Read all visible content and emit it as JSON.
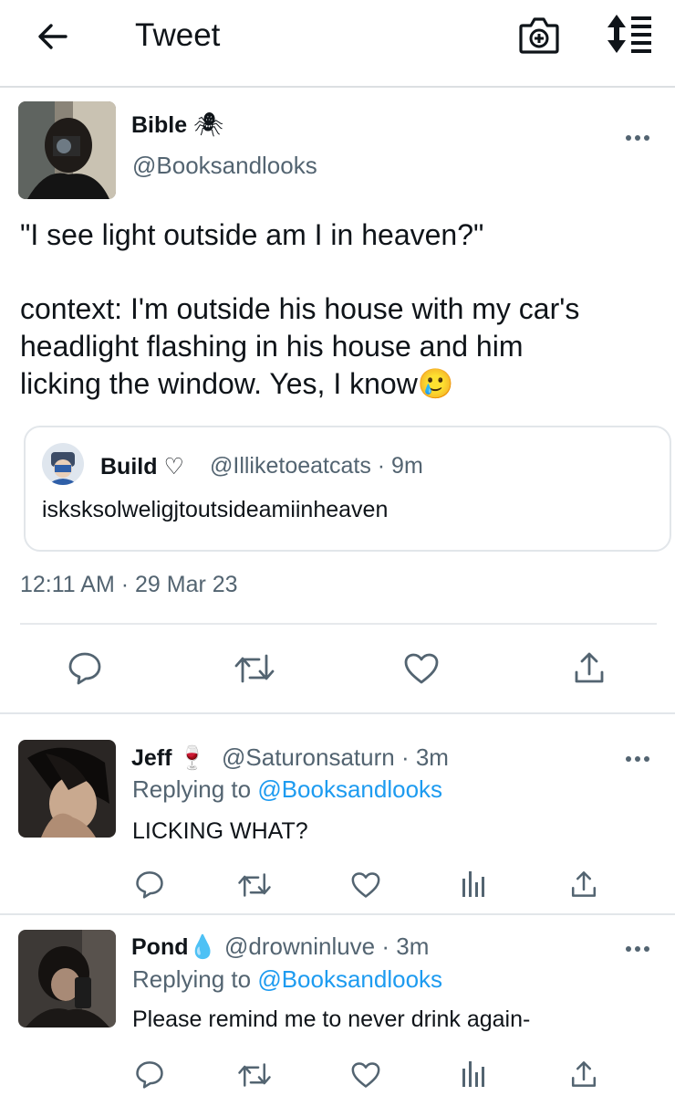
{
  "header": {
    "title": "Tweet",
    "back_icon": "arrow-left-icon",
    "camera_icon": "camera-plus-icon",
    "sort_icon": "sort-icon"
  },
  "main_tweet": {
    "name": "Bible",
    "name_emoji": "🕷",
    "handle": "@Booksandlooks",
    "text_line1": "\"I see light outside am I in heaven?\"",
    "text_body": "context: I'm outside his house with my car's\nheadlight flashing in his house and him\nlicking the window. Yes, I know",
    "text_emoji": "🥲",
    "quote": {
      "name": "Build",
      "name_symbol": "♡",
      "handle": "@Illiketoeatcats · 9m",
      "text": "isksksolweligjtoutsideamiinheaven"
    },
    "timestamp": "12:11 AM · 29 Mar 23"
  },
  "replies": [
    {
      "name": "Jeff",
      "name_emoji": "🍷",
      "handle": "@Saturonsaturn · 3m",
      "replying_prefix": "Replying to",
      "replying_to": "@Booksandlooks",
      "text": "LICKING WHAT?"
    },
    {
      "name": "Pond",
      "name_emoji": "💧",
      "handle": "@drowninluve · 3m",
      "replying_prefix": "Replying to",
      "replying_to": "@Booksandlooks",
      "text": "Please remind me to never drink again-"
    }
  ],
  "colors": {
    "text": "#0f1419",
    "secondary": "#536471",
    "link": "#1d9bf0",
    "border": "#e2e6ea"
  }
}
